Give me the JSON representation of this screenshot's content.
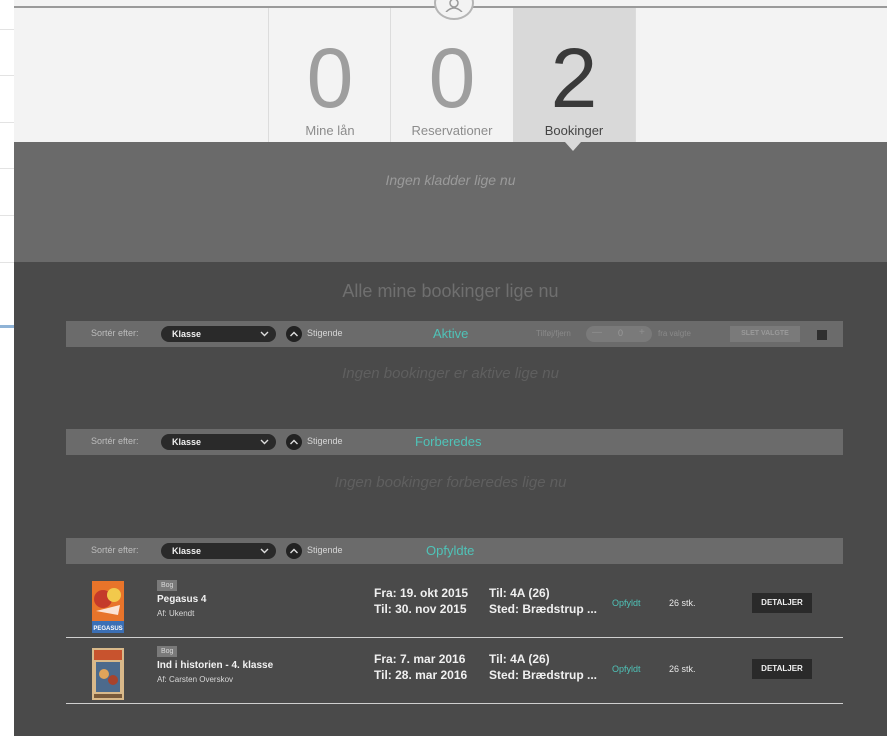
{
  "stats": [
    {
      "value": "0",
      "label": "Mine lån"
    },
    {
      "value": "0",
      "label": "Reservationer"
    },
    {
      "value": "2",
      "label": "Bookinger"
    }
  ],
  "drafts_message": "Ingen kladder lige nu",
  "main_title": "Alle mine bookinger lige nu",
  "sort_label": "Sortér efter:",
  "sort_value": "Klasse",
  "order_label": "Stigende",
  "sections": {
    "aktive": {
      "title": "Aktive",
      "empty": "Ingen bookinger er aktive lige nu",
      "add_remove_label": "Tilføj/fjern",
      "qty_minus": "—",
      "qty_value": "0",
      "qty_plus": "+",
      "selected_label": "fra valgte",
      "delete_label": "SLET VALGTE"
    },
    "forberedes": {
      "title": "Forberedes",
      "empty": "Ingen bookinger forberedes lige nu"
    },
    "opfyldte": {
      "title": "Opfyldte"
    }
  },
  "bookings": [
    {
      "type": "Bog",
      "title": "Pegasus 4",
      "author": "Af: Ukendt",
      "from": "Fra: 19. okt 2015",
      "to": "Til: 30. nov 2015",
      "class": "Til:  4A (26)",
      "place": "Sted:  Brædstrup ...",
      "status": "Opfyldt",
      "count": "26 stk.",
      "action": "DETALJER",
      "cover_text": "PEGASUS"
    },
    {
      "type": "Bog",
      "title": "Ind i historien - 4. klasse",
      "author": "Af: Carsten Overskov",
      "from": "Fra: 7. mar 2016",
      "to": "Til: 28. mar 2016",
      "class": "Til:  4A (26)",
      "place": "Sted:  Brædstrup ...",
      "status": "Opfyldt",
      "count": "26 stk.",
      "action": "DETALJER"
    }
  ],
  "colors": {
    "accent": "#4fc3b8",
    "dark_bg": "#4a4a4a",
    "bar_bg": "#6b6b6b",
    "button_bg": "#2a2a2a"
  }
}
